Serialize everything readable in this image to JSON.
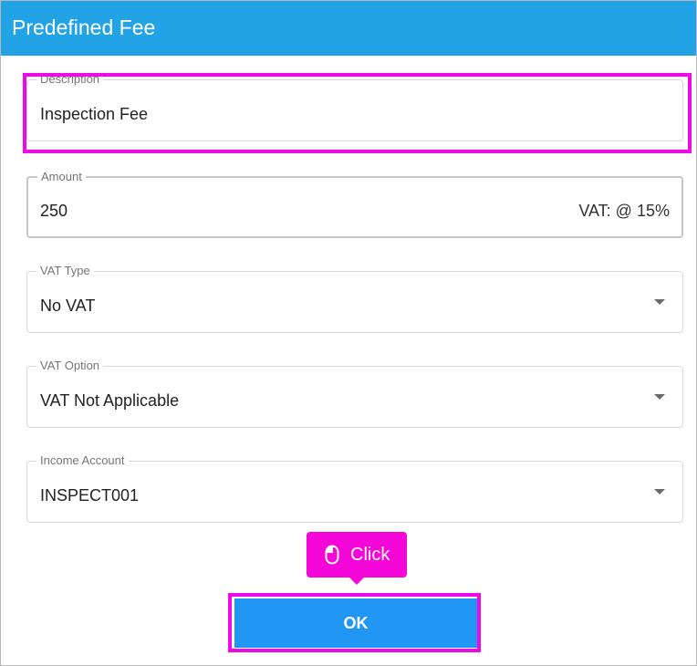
{
  "dialog": {
    "title": "Predefined Fee"
  },
  "fields": {
    "description": {
      "label": "Description",
      "value": "Inspection Fee"
    },
    "amount": {
      "label": "Amount",
      "value": "250",
      "suffix": "VAT: @ 15%"
    },
    "vat_type": {
      "label": "VAT Type",
      "value": "No VAT"
    },
    "vat_option": {
      "label": "VAT Option",
      "value": "VAT Not Applicable"
    },
    "income_account": {
      "label": "Income Account",
      "value": "INSPECT001"
    }
  },
  "tooltip": {
    "icon": "mouse-icon",
    "text": "Click"
  },
  "actions": {
    "ok_label": "OK"
  },
  "colors": {
    "titlebar": "#22a3e6",
    "primary_button": "#2196f3",
    "highlight": "#ee0ae8",
    "tooltip": "#f405d8"
  }
}
